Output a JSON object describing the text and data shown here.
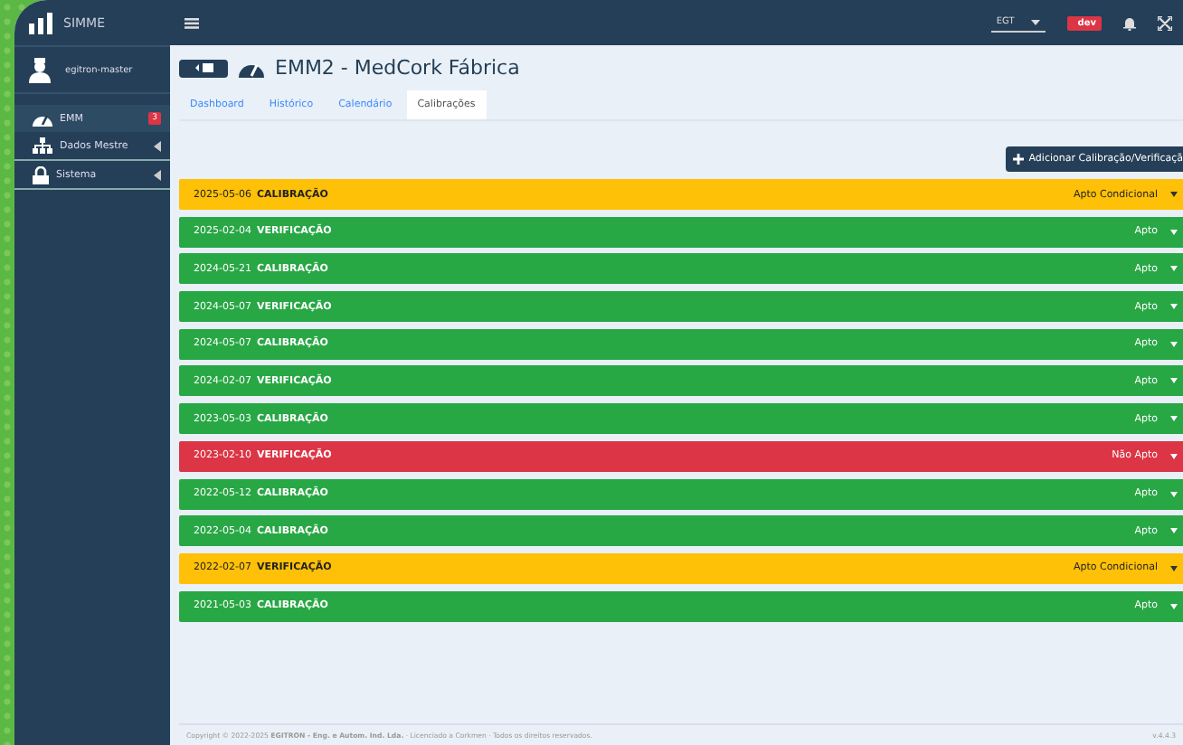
{
  "brand": "SIMME",
  "user": "egitron-master",
  "sidebar": {
    "items": [
      {
        "label": "EMM",
        "badge": "3",
        "selected": true,
        "expandable": false
      },
      {
        "label": "Dados Mestre",
        "selected": false,
        "expandable": true
      },
      {
        "label": "Sistema",
        "selected": false,
        "expandable": true
      }
    ]
  },
  "topbar": {
    "timezone": "EGT",
    "env_badge": "dev"
  },
  "page": {
    "title": "EMM2 - MedCork Fábrica"
  },
  "tabs": [
    {
      "label": "Dashboard",
      "selected": false
    },
    {
      "label": "Histórico",
      "selected": false
    },
    {
      "label": "Calendário",
      "selected": false
    },
    {
      "label": "Calibrações",
      "selected": true
    }
  ],
  "add_button": "Adicionar Calibração/Verificaçã",
  "records": [
    {
      "date": "2025-05-06",
      "type": "CALIBRAÇÃO",
      "result": "Apto Condicional",
      "kind": "warning"
    },
    {
      "date": "2025-02-04",
      "type": "VERIFICAÇÃO",
      "result": "Apto",
      "kind": "success"
    },
    {
      "date": "2024-05-21",
      "type": "CALIBRAÇÃO",
      "result": "Apto",
      "kind": "success"
    },
    {
      "date": "2024-05-07",
      "type": "VERIFICAÇÃO",
      "result": "Apto",
      "kind": "success"
    },
    {
      "date": "2024-05-07",
      "type": "CALIBRAÇÃO",
      "result": "Apto",
      "kind": "success"
    },
    {
      "date": "2024-02-07",
      "type": "VERIFICAÇÃO",
      "result": "Apto",
      "kind": "success"
    },
    {
      "date": "2023-05-03",
      "type": "CALIBRAÇÃO",
      "result": "Apto",
      "kind": "success"
    },
    {
      "date": "2023-02-10",
      "type": "VERIFICAÇÃO",
      "result": "Não Apto",
      "kind": "danger"
    },
    {
      "date": "2022-05-12",
      "type": "CALIBRAÇÃO",
      "result": "Apto",
      "kind": "success"
    },
    {
      "date": "2022-05-04",
      "type": "CALIBRAÇÃO",
      "result": "Apto",
      "kind": "success"
    },
    {
      "date": "2022-02-07",
      "type": "VERIFICAÇÃO",
      "result": "Apto Condicional",
      "kind": "warning"
    },
    {
      "date": "2021-05-03",
      "type": "CALIBRAÇÃO",
      "result": "Apto",
      "kind": "success"
    }
  ],
  "footer": {
    "text": "Copyright © 2022-2025 **EGITRON - Eng. e Autom. Ind. Lda.** · Licenciado a Corkmen · Todos os direitos reservados.",
    "version": "v.4.4.3"
  }
}
